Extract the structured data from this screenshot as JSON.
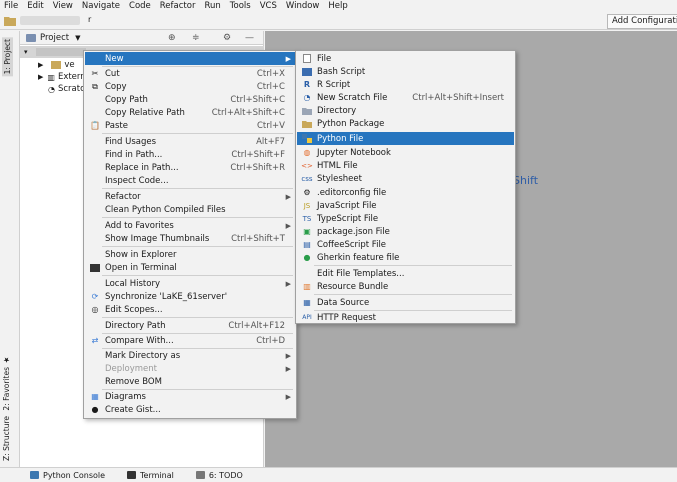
{
  "menubar": [
    "File",
    "Edit",
    "View",
    "Navigate",
    "Code",
    "Refactor",
    "Run",
    "Tools",
    "VCS",
    "Window",
    "Help"
  ],
  "toolbar": {
    "caret": "r",
    "add_config": "Add Configurati"
  },
  "side_tabs": {
    "project": "1: Project",
    "favorites": "2: Favorites",
    "structure": "Z: Structure"
  },
  "project_panel": {
    "title": "Project",
    "tree": [
      {
        "label": "ve"
      },
      {
        "label": "Extern"
      },
      {
        "label": "Scratc"
      }
    ]
  },
  "editor": {
    "hint": "Shift"
  },
  "context_menu": [
    {
      "label": "New",
      "shortcut": "",
      "submenu": true,
      "highlight": true,
      "icon": ""
    },
    {
      "label": "Cut",
      "shortcut": "Ctrl+X",
      "icon": "scissors-icon"
    },
    {
      "label": "Copy",
      "shortcut": "Ctrl+C",
      "icon": "copy-icon"
    },
    {
      "label": "Copy Path",
      "shortcut": "Ctrl+Shift+C"
    },
    {
      "label": "Copy Relative Path",
      "shortcut": "Ctrl+Alt+Shift+C"
    },
    {
      "label": "Paste",
      "shortcut": "Ctrl+V",
      "icon": "paste-icon"
    },
    {
      "label": "Find Usages",
      "shortcut": "Alt+F7"
    },
    {
      "label": "Find in Path...",
      "shortcut": "Ctrl+Shift+F"
    },
    {
      "label": "Replace in Path...",
      "shortcut": "Ctrl+Shift+R"
    },
    {
      "label": "Inspect Code..."
    },
    {
      "label": "Refactor",
      "submenu": true
    },
    {
      "label": "Clean Python Compiled Files"
    },
    {
      "label": "Add to Favorites",
      "submenu": true
    },
    {
      "label": "Show Image Thumbnails",
      "shortcut": "Ctrl+Shift+T"
    },
    {
      "label": "Show in Explorer"
    },
    {
      "label": "Open in Terminal",
      "icon": "terminal-icon"
    },
    {
      "label": "Local History",
      "submenu": true
    },
    {
      "label": "Synchronize 'LaKE_61server'",
      "icon": "sync-icon"
    },
    {
      "label": "Edit Scopes...",
      "icon": "scopes-icon"
    },
    {
      "label": "Directory Path",
      "shortcut": "Ctrl+Alt+F12"
    },
    {
      "label": "Compare With...",
      "shortcut": "Ctrl+D",
      "icon": "compare-icon"
    },
    {
      "label": "Mark Directory as",
      "submenu": true
    },
    {
      "label": "Deployment",
      "submenu": true,
      "disabled": true
    },
    {
      "label": "Remove BOM"
    },
    {
      "label": "Diagrams",
      "submenu": true,
      "icon": "diagram-icon"
    },
    {
      "label": "Create Gist...",
      "icon": "github-icon"
    }
  ],
  "new_submenu": [
    {
      "label": "File",
      "icon": "file-icon"
    },
    {
      "label": "Bash Script",
      "icon": "bash-icon"
    },
    {
      "label": "R Script",
      "icon": "r-icon"
    },
    {
      "label": "New Scratch File",
      "shortcut": "Ctrl+Alt+Shift+Insert",
      "icon": "scratch-icon"
    },
    {
      "label": "Directory",
      "icon": "folder-icon"
    },
    {
      "label": "Python Package",
      "icon": "package-icon"
    },
    {
      "label": "Python File",
      "icon": "python-icon",
      "highlight": true
    },
    {
      "label": "Jupyter Notebook",
      "icon": "jupyter-icon"
    },
    {
      "label": "HTML File",
      "icon": "html-icon"
    },
    {
      "label": "Stylesheet",
      "icon": "css-icon"
    },
    {
      "label": ".editorconfig file",
      "icon": "gear-icon"
    },
    {
      "label": "JavaScript File",
      "icon": "js-icon"
    },
    {
      "label": "TypeScript File",
      "icon": "ts-icon"
    },
    {
      "label": "package.json File",
      "icon": "npm-icon"
    },
    {
      "label": "CoffeeScript File",
      "icon": "coffee-icon"
    },
    {
      "label": "Gherkin feature file",
      "icon": "gherkin-icon"
    },
    {
      "label": "Edit File Templates..."
    },
    {
      "label": "Resource Bundle",
      "icon": "bundle-icon"
    },
    {
      "label": "Data Source",
      "icon": "datasource-icon"
    },
    {
      "label": "HTTP Request",
      "icon": "http-icon"
    }
  ],
  "status_tabs": [
    {
      "label": "Python Console",
      "icon": "python-console-icon"
    },
    {
      "label": "Terminal",
      "icon": "terminal-icon"
    },
    {
      "label": "6: TODO",
      "icon": "todo-icon"
    }
  ],
  "colors": {
    "highlight": "#2675bf",
    "menu_bg": "#f2f2f2",
    "editor_bg": "#a9a9a9",
    "hint": "#2f5ea8"
  }
}
